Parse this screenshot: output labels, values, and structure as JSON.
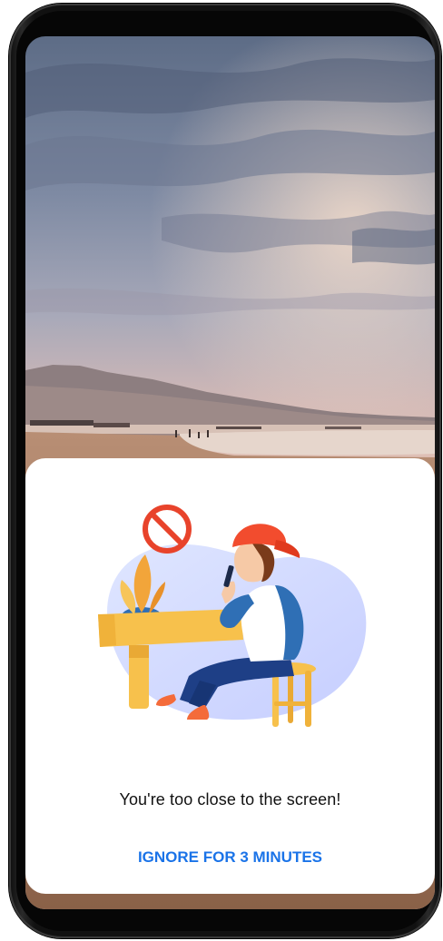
{
  "dialog": {
    "message": "You're too close to the screen!",
    "ignore_button_label": "IGNORE FOR 3 MINUTES"
  },
  "icons": {
    "illustration": "child-using-phone-too-close-illustration",
    "prohibited": "prohibited-icon"
  },
  "colors": {
    "accent": "#1a73e8",
    "dialog_background": "#ffffff"
  }
}
